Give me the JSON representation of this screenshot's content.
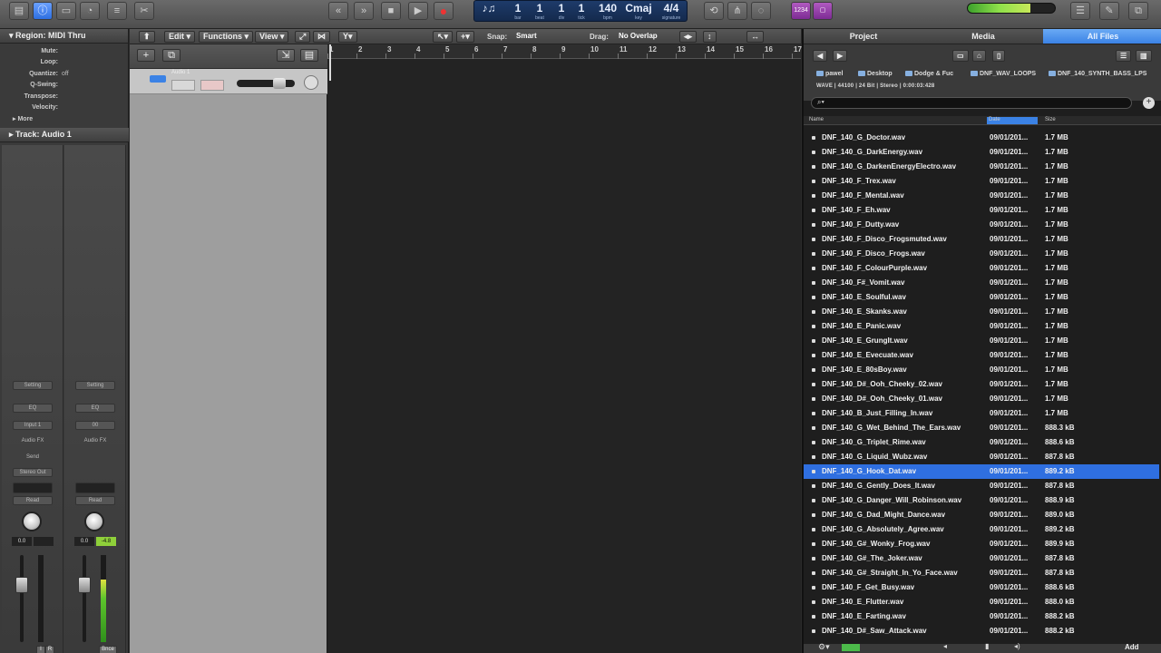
{
  "toolbar": {
    "lcd": [
      {
        "value": "1",
        "caption": "bar"
      },
      {
        "value": "1",
        "caption": "beat"
      },
      {
        "value": "1",
        "caption": "div"
      },
      {
        "value": "1",
        "caption": "tick"
      },
      {
        "value": "140",
        "caption": "bpm"
      },
      {
        "value": "Cmaj",
        "caption": "key"
      },
      {
        "value": "4/4",
        "caption": "signature"
      }
    ],
    "master_level": 0.72,
    "colors": {
      "accent": "#3b82e5",
      "record": "#e33333"
    }
  },
  "inspector": {
    "region_title": "Region: MIDI Thru",
    "params": [
      {
        "label": "Mute:",
        "value": ""
      },
      {
        "label": "Loop:",
        "value": ""
      },
      {
        "label": "Quantize:",
        "value": "off"
      },
      {
        "label": "Q-Swing:",
        "value": ""
      },
      {
        "label": "Transpose:",
        "value": ""
      },
      {
        "label": "Velocity:",
        "value": ""
      }
    ],
    "more_label": "More",
    "track_title": "Track:  Audio 1",
    "strip1": {
      "setting": "Setting",
      "eq": "EQ",
      "input": "Input 1",
      "audio_fx": "Audio FX",
      "send": "Send",
      "output": "Stereo Out",
      "automation": "Read",
      "volume": "0.0",
      "peak": "",
      "mute": "M",
      "solo": "S",
      "input_mon": "I",
      "rec": "R",
      "name": "Audio 1",
      "meter_level": 0.0
    },
    "strip2": {
      "setting": "Setting",
      "eq": "EQ",
      "input": "00",
      "audio_fx": "Audio FX",
      "automation": "Read",
      "volume": "0.0",
      "peak": "-4.8",
      "mute": "M",
      "bounce": "Bnce",
      "name": "Output",
      "meter_level": 0.72
    }
  },
  "tracks": {
    "menus": {
      "edit": "Edit",
      "functions": "Functions",
      "view": "View"
    },
    "snap_label": "Snap:",
    "snap_value": "Smart",
    "drag_label": "Drag:",
    "drag_value": "No Overlap",
    "track_name": "Audio 1",
    "bars": [
      "1",
      "2",
      "3",
      "4",
      "5",
      "6",
      "7",
      "8",
      "9",
      "10",
      "11",
      "12",
      "13",
      "14",
      "15",
      "16",
      "17"
    ]
  },
  "browser": {
    "tabs": [
      "Project",
      "Media",
      "All Files"
    ],
    "path": [
      "pawel",
      "Desktop",
      "Dodge & Fuc",
      "DNF_WAV_LOOPS",
      "DNF_140_SYNTH_BASS_LPS"
    ],
    "file_info": "WAVE  |  44100  |  24 Bit  |  Stereo  |  0:00:03:428",
    "columns": {
      "name": "Name",
      "date": "Date",
      "size": "Size"
    },
    "files": [
      {
        "name": "DNF_140_G_Doctor.wav",
        "date": "09/01/201...",
        "size": "1.7 MB"
      },
      {
        "name": "DNF_140_G_DarkEnergy.wav",
        "date": "09/01/201...",
        "size": "1.7 MB"
      },
      {
        "name": "DNF_140_G_DarkenEnergyElectro.wav",
        "date": "09/01/201...",
        "size": "1.7 MB"
      },
      {
        "name": "DNF_140_F_Trex.wav",
        "date": "09/01/201...",
        "size": "1.7 MB"
      },
      {
        "name": "DNF_140_F_Mental.wav",
        "date": "09/01/201...",
        "size": "1.7 MB"
      },
      {
        "name": "DNF_140_F_Eh.wav",
        "date": "09/01/201...",
        "size": "1.7 MB"
      },
      {
        "name": "DNF_140_F_Dutty.wav",
        "date": "09/01/201...",
        "size": "1.7 MB"
      },
      {
        "name": "DNF_140_F_Disco_Frogsmuted.wav",
        "date": "09/01/201...",
        "size": "1.7 MB"
      },
      {
        "name": "DNF_140_F_Disco_Frogs.wav",
        "date": "09/01/201...",
        "size": "1.7 MB"
      },
      {
        "name": "DNF_140_F_ColourPurple.wav",
        "date": "09/01/201...",
        "size": "1.7 MB"
      },
      {
        "name": "DNF_140_F#_Vomit.wav",
        "date": "09/01/201...",
        "size": "1.7 MB"
      },
      {
        "name": "DNF_140_E_Soulful.wav",
        "date": "09/01/201...",
        "size": "1.7 MB"
      },
      {
        "name": "DNF_140_E_Skanks.wav",
        "date": "09/01/201...",
        "size": "1.7 MB"
      },
      {
        "name": "DNF_140_E_Panic.wav",
        "date": "09/01/201...",
        "size": "1.7 MB"
      },
      {
        "name": "DNF_140_E_GrungIt.wav",
        "date": "09/01/201...",
        "size": "1.7 MB"
      },
      {
        "name": "DNF_140_E_Evecuate.wav",
        "date": "09/01/201...",
        "size": "1.7 MB"
      },
      {
        "name": "DNF_140_E_80sBoy.wav",
        "date": "09/01/201...",
        "size": "1.7 MB"
      },
      {
        "name": "DNF_140_D#_Ooh_Cheeky_02.wav",
        "date": "09/01/201...",
        "size": "1.7 MB"
      },
      {
        "name": "DNF_140_D#_Ooh_Cheeky_01.wav",
        "date": "09/01/201...",
        "size": "1.7 MB"
      },
      {
        "name": "DNF_140_B_Just_Filling_In.wav",
        "date": "09/01/201...",
        "size": "1.7 MB"
      },
      {
        "name": "DNF_140_G_Wet_Behind_The_Ears.wav",
        "date": "09/01/201...",
        "size": "888.3 kB"
      },
      {
        "name": "DNF_140_G_Triplet_Rime.wav",
        "date": "09/01/201...",
        "size": "888.6 kB"
      },
      {
        "name": "DNF_140_G_Liquid_Wubz.wav",
        "date": "09/01/201...",
        "size": "887.8 kB"
      },
      {
        "name": "DNF_140_G_Hook_Dat.wav",
        "date": "09/01/201...",
        "size": "889.2 kB",
        "selected": true
      },
      {
        "name": "DNF_140_G_Gently_Does_It.wav",
        "date": "09/01/201...",
        "size": "887.8 kB"
      },
      {
        "name": "DNF_140_G_Danger_Will_Robinson.wav",
        "date": "09/01/201...",
        "size": "888.9 kB"
      },
      {
        "name": "DNF_140_G_Dad_Might_Dance.wav",
        "date": "09/01/201...",
        "size": "889.0 kB"
      },
      {
        "name": "DNF_140_G_Absolutely_Agree.wav",
        "date": "09/01/201...",
        "size": "889.2 kB"
      },
      {
        "name": "DNF_140_G#_Wonky_Frog.wav",
        "date": "09/01/201...",
        "size": "889.9 kB"
      },
      {
        "name": "DNF_140_G#_The_Joker.wav",
        "date": "09/01/201...",
        "size": "887.8 kB"
      },
      {
        "name": "DNF_140_G#_Straight_In_Yo_Face.wav",
        "date": "09/01/201...",
        "size": "887.8 kB"
      },
      {
        "name": "DNF_140_F_Get_Busy.wav",
        "date": "09/01/201...",
        "size": "888.6 kB"
      },
      {
        "name": "DNF_140_E_Flutter.wav",
        "date": "09/01/201...",
        "size": "888.0 kB"
      },
      {
        "name": "DNF_140_E_Farting.wav",
        "date": "09/01/201...",
        "size": "888.2 kB"
      },
      {
        "name": "DNF_140_D#_Saw_Attack.wav",
        "date": "09/01/201...",
        "size": "888.2 kB"
      }
    ],
    "add_label": "Add"
  }
}
